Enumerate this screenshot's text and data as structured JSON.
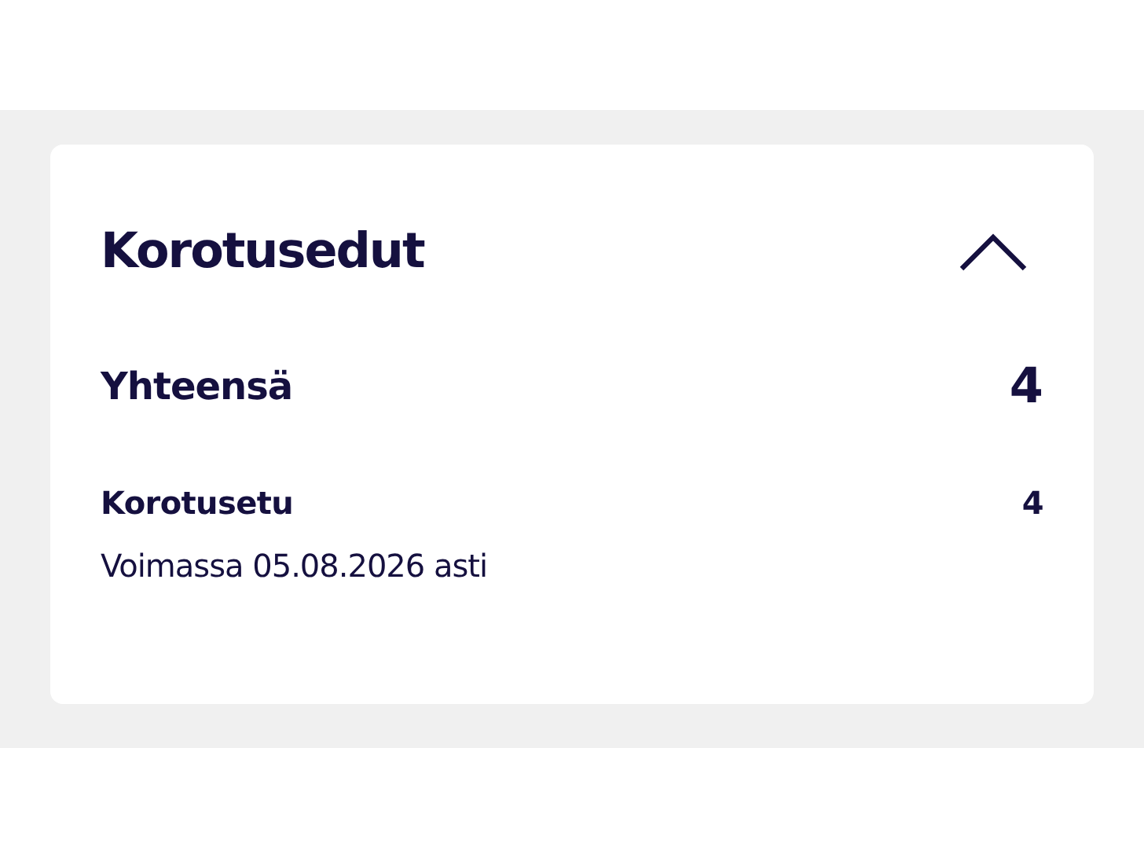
{
  "card": {
    "title": "Korotusedut",
    "expanded": true,
    "total": {
      "label": "Yhteensä",
      "value": "4"
    },
    "items": [
      {
        "name": "Korotusetu",
        "value": "4",
        "validity": "Voimassa 05.08.2026 asti"
      }
    ]
  }
}
